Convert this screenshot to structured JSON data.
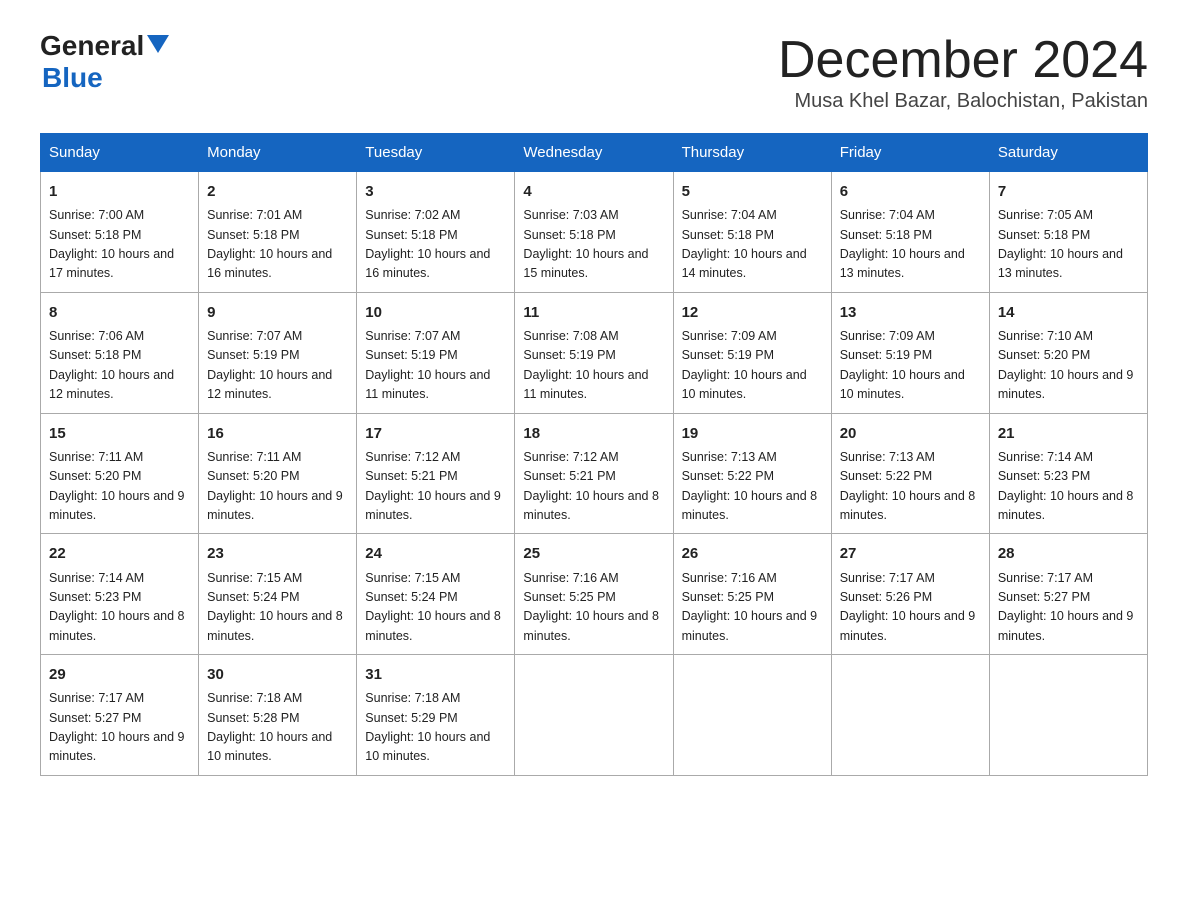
{
  "header": {
    "logo_general": "General",
    "logo_blue": "Blue",
    "month_title": "December 2024",
    "location": "Musa Khel Bazar, Balochistan, Pakistan"
  },
  "weekdays": [
    "Sunday",
    "Monday",
    "Tuesday",
    "Wednesday",
    "Thursday",
    "Friday",
    "Saturday"
  ],
  "weeks": [
    [
      {
        "day": "1",
        "sunrise": "7:00 AM",
        "sunset": "5:18 PM",
        "daylight": "10 hours and 17 minutes."
      },
      {
        "day": "2",
        "sunrise": "7:01 AM",
        "sunset": "5:18 PM",
        "daylight": "10 hours and 16 minutes."
      },
      {
        "day": "3",
        "sunrise": "7:02 AM",
        "sunset": "5:18 PM",
        "daylight": "10 hours and 16 minutes."
      },
      {
        "day": "4",
        "sunrise": "7:03 AM",
        "sunset": "5:18 PM",
        "daylight": "10 hours and 15 minutes."
      },
      {
        "day": "5",
        "sunrise": "7:04 AM",
        "sunset": "5:18 PM",
        "daylight": "10 hours and 14 minutes."
      },
      {
        "day": "6",
        "sunrise": "7:04 AM",
        "sunset": "5:18 PM",
        "daylight": "10 hours and 13 minutes."
      },
      {
        "day": "7",
        "sunrise": "7:05 AM",
        "sunset": "5:18 PM",
        "daylight": "10 hours and 13 minutes."
      }
    ],
    [
      {
        "day": "8",
        "sunrise": "7:06 AM",
        "sunset": "5:18 PM",
        "daylight": "10 hours and 12 minutes."
      },
      {
        "day": "9",
        "sunrise": "7:07 AM",
        "sunset": "5:19 PM",
        "daylight": "10 hours and 12 minutes."
      },
      {
        "day": "10",
        "sunrise": "7:07 AM",
        "sunset": "5:19 PM",
        "daylight": "10 hours and 11 minutes."
      },
      {
        "day": "11",
        "sunrise": "7:08 AM",
        "sunset": "5:19 PM",
        "daylight": "10 hours and 11 minutes."
      },
      {
        "day": "12",
        "sunrise": "7:09 AM",
        "sunset": "5:19 PM",
        "daylight": "10 hours and 10 minutes."
      },
      {
        "day": "13",
        "sunrise": "7:09 AM",
        "sunset": "5:19 PM",
        "daylight": "10 hours and 10 minutes."
      },
      {
        "day": "14",
        "sunrise": "7:10 AM",
        "sunset": "5:20 PM",
        "daylight": "10 hours and 9 minutes."
      }
    ],
    [
      {
        "day": "15",
        "sunrise": "7:11 AM",
        "sunset": "5:20 PM",
        "daylight": "10 hours and 9 minutes."
      },
      {
        "day": "16",
        "sunrise": "7:11 AM",
        "sunset": "5:20 PM",
        "daylight": "10 hours and 9 minutes."
      },
      {
        "day": "17",
        "sunrise": "7:12 AM",
        "sunset": "5:21 PM",
        "daylight": "10 hours and 9 minutes."
      },
      {
        "day": "18",
        "sunrise": "7:12 AM",
        "sunset": "5:21 PM",
        "daylight": "10 hours and 8 minutes."
      },
      {
        "day": "19",
        "sunrise": "7:13 AM",
        "sunset": "5:22 PM",
        "daylight": "10 hours and 8 minutes."
      },
      {
        "day": "20",
        "sunrise": "7:13 AM",
        "sunset": "5:22 PM",
        "daylight": "10 hours and 8 minutes."
      },
      {
        "day": "21",
        "sunrise": "7:14 AM",
        "sunset": "5:23 PM",
        "daylight": "10 hours and 8 minutes."
      }
    ],
    [
      {
        "day": "22",
        "sunrise": "7:14 AM",
        "sunset": "5:23 PM",
        "daylight": "10 hours and 8 minutes."
      },
      {
        "day": "23",
        "sunrise": "7:15 AM",
        "sunset": "5:24 PM",
        "daylight": "10 hours and 8 minutes."
      },
      {
        "day": "24",
        "sunrise": "7:15 AM",
        "sunset": "5:24 PM",
        "daylight": "10 hours and 8 minutes."
      },
      {
        "day": "25",
        "sunrise": "7:16 AM",
        "sunset": "5:25 PM",
        "daylight": "10 hours and 8 minutes."
      },
      {
        "day": "26",
        "sunrise": "7:16 AM",
        "sunset": "5:25 PM",
        "daylight": "10 hours and 9 minutes."
      },
      {
        "day": "27",
        "sunrise": "7:17 AM",
        "sunset": "5:26 PM",
        "daylight": "10 hours and 9 minutes."
      },
      {
        "day": "28",
        "sunrise": "7:17 AM",
        "sunset": "5:27 PM",
        "daylight": "10 hours and 9 minutes."
      }
    ],
    [
      {
        "day": "29",
        "sunrise": "7:17 AM",
        "sunset": "5:27 PM",
        "daylight": "10 hours and 9 minutes."
      },
      {
        "day": "30",
        "sunrise": "7:18 AM",
        "sunset": "5:28 PM",
        "daylight": "10 hours and 10 minutes."
      },
      {
        "day": "31",
        "sunrise": "7:18 AM",
        "sunset": "5:29 PM",
        "daylight": "10 hours and 10 minutes."
      },
      null,
      null,
      null,
      null
    ]
  ]
}
